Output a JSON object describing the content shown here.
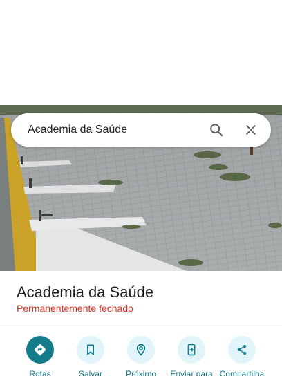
{
  "search": {
    "value": "Academia da Saúde"
  },
  "place": {
    "title": "Academia da Saúde",
    "status": "Permanentemente fechado"
  },
  "actions": [
    {
      "label": "Rotas",
      "icon": "directions-icon"
    },
    {
      "label": "Salvar",
      "icon": "bookmark-icon"
    },
    {
      "label": "Próximo",
      "icon": "nearby-icon"
    },
    {
      "label": "Enviar para",
      "icon": "send-to-device-icon"
    },
    {
      "label": "Compartilha",
      "icon": "share-icon"
    }
  ],
  "colors": {
    "accent": "#137b8a",
    "status_closed": "#d93025",
    "action_bg": "#e0f4f9"
  }
}
